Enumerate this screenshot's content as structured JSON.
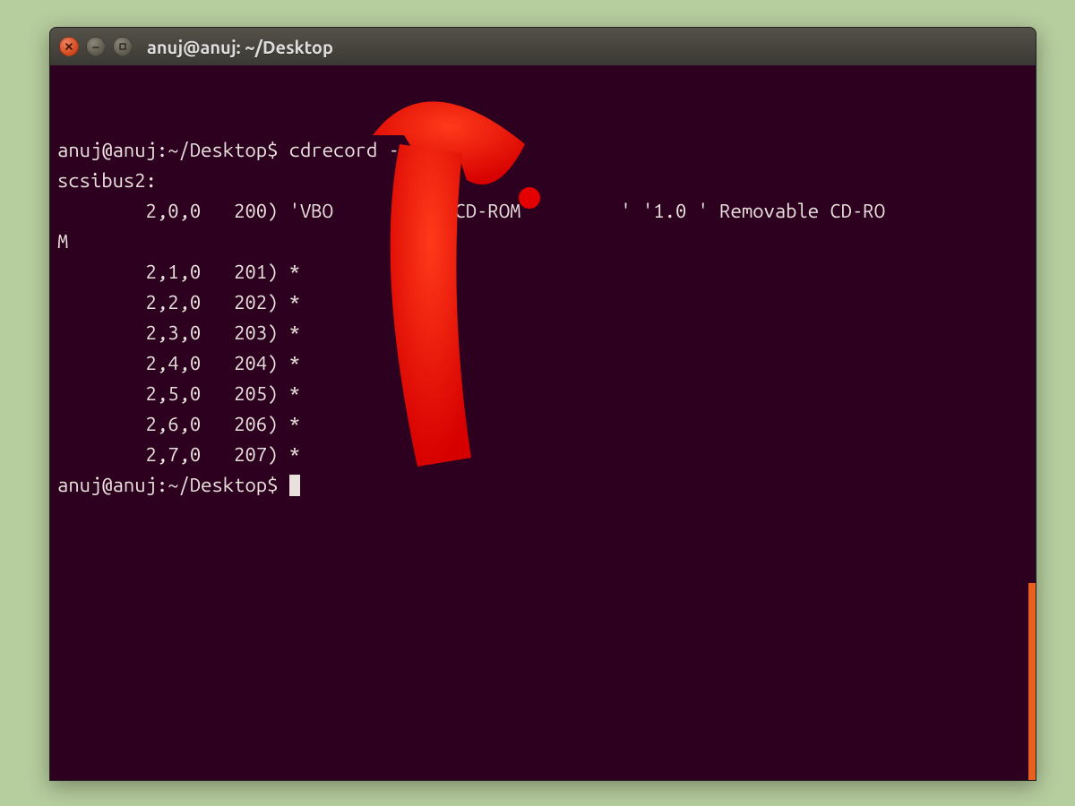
{
  "window": {
    "title": "anuj@anuj: ~/Desktop"
  },
  "terminal": {
    "prompt1": "anuj@anuj:~/Desktop$ ",
    "command1": "cdrecord -scanbus",
    "scsi_header": "scsibus2:",
    "line_dev0_a": "        2,0,0   200) 'VBO",
    "line_dev0_b": "CD-ROM         ' '1.0 ' Removable CD-RO",
    "line_dev0_wrap": "M",
    "line_dev1": "        2,1,0   201) *",
    "line_dev2": "        2,2,0   202) *",
    "line_dev3": "        2,3,0   203) *",
    "line_dev4": "        2,4,0   204) *",
    "line_dev5": "        2,5,0   205) *",
    "line_dev6": "        2,6,0   206) *",
    "line_dev7": "        2,7,0   207) *",
    "prompt2": "anuj@anuj:~/Desktop$ "
  },
  "annotation": {
    "arrow_color": "#ff0000"
  }
}
